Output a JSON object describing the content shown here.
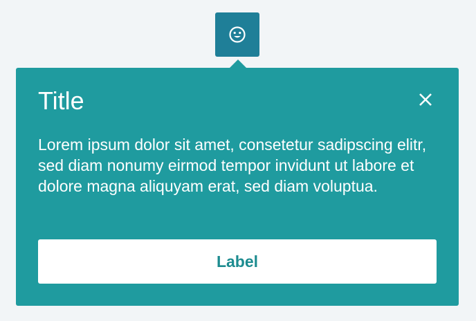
{
  "trigger": {
    "icon": "smiley-face-icon",
    "color": "#1f7f98"
  },
  "popover": {
    "title": "Title",
    "close_icon": "close-icon",
    "body": "Lorem ipsum dolor sit amet, consetetur sadipscing elitr, sed diam nonumy eirmod tempor invidunt ut labore et dolore magna aliquyam erat, sed diam voluptua.",
    "button_label": "Label",
    "background_color": "#1f9b9f",
    "accent_color": "#1d8c90"
  }
}
